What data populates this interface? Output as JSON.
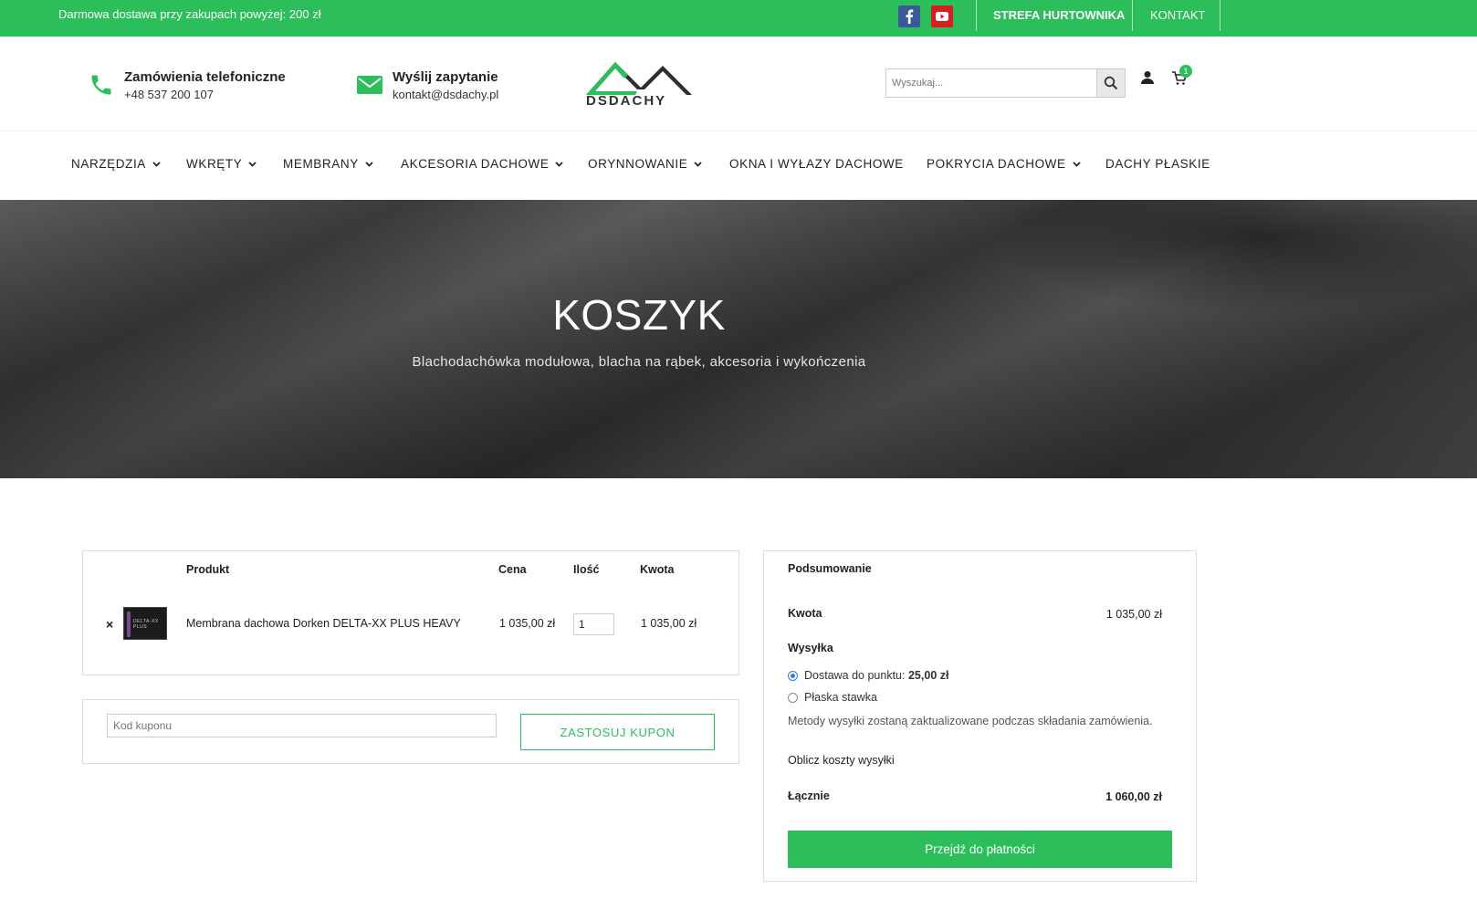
{
  "topbar": {
    "promo": "Darmowa dostawa przy zakupach powyżej: 200 zł",
    "links": [
      "STREFA HURTOWNIKA",
      "KONTAKT"
    ]
  },
  "header": {
    "phone": {
      "title": "Zamówienia telefoniczne",
      "value": "+48 537 200 107"
    },
    "email": {
      "title": "Wyślij zapytanie",
      "value": "kontakt@dsdachy.pl"
    },
    "logo_text": "DSDACHY",
    "search_placeholder": "Wyszukaj...",
    "cart_count": "1"
  },
  "nav": {
    "items": [
      {
        "label": "NARZĘDZIA",
        "dropdown": true
      },
      {
        "label": "WKRĘTY",
        "dropdown": true
      },
      {
        "label": "MEMBRANY",
        "dropdown": true
      },
      {
        "label": "AKCESORIA DACHOWE",
        "dropdown": true
      },
      {
        "label": "ORYNNOWANIE",
        "dropdown": true
      },
      {
        "label": "OKNA I WYŁAZY DACHOWE",
        "dropdown": false
      },
      {
        "label": "POKRYCIA DACHOWE",
        "dropdown": true
      },
      {
        "label": "DACHY PŁASKIE",
        "dropdown": false
      }
    ]
  },
  "hero": {
    "title": "KOSZYK",
    "subtitle": "Blachodachówka modułowa, blacha na rąbek, akcesoria i wykończenia"
  },
  "cart": {
    "headers": {
      "product": "Produkt",
      "price": "Cena",
      "qty": "Ilość",
      "amount": "Kwota"
    },
    "items": [
      {
        "name": "Membrana dachowa Dorken DELTA-XX PLUS HEAVY",
        "price": "1 035,00 zł",
        "qty": "1",
        "amount": "1 035,00 zł",
        "thumb_text": "DELTA-XX PLUS"
      }
    ],
    "remove_symbol": "×"
  },
  "coupon": {
    "placeholder": "Kod kuponu",
    "button": "ZASTOSUJ KUPON"
  },
  "summary": {
    "title": "Podsumowanie",
    "subtotal_label": "Kwota",
    "subtotal_value": "1 035,00 zł",
    "shipping_label": "Wysyłka",
    "shipping_options": [
      {
        "label": "Dostawa do punktu:",
        "price": "25,00 zł",
        "selected": true
      },
      {
        "label": "Płaska stawka",
        "price": "",
        "selected": false
      }
    ],
    "shipping_note": "Metody wysyłki zostaną zaktualizowane podczas składania zamówienia.",
    "calc_link": "Oblicz koszty wysyłki",
    "total_label": "Łącznie",
    "total_value": "1 060,00 zł",
    "checkout_button": "Przejdź do płatności"
  },
  "colors": {
    "accent": "#2dbe5c",
    "facebook": "#3b5998",
    "youtube": "#d81f1f"
  }
}
